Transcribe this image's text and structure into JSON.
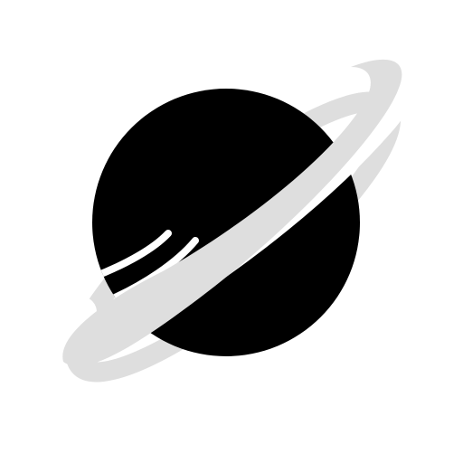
{
  "icon": {
    "name": "planet-ring-icon",
    "colors": {
      "background": "#ffffff",
      "planet": "#000000",
      "ring": "#dedede",
      "ring_gap": "#ffffff",
      "stripes": "#ffffff"
    }
  }
}
